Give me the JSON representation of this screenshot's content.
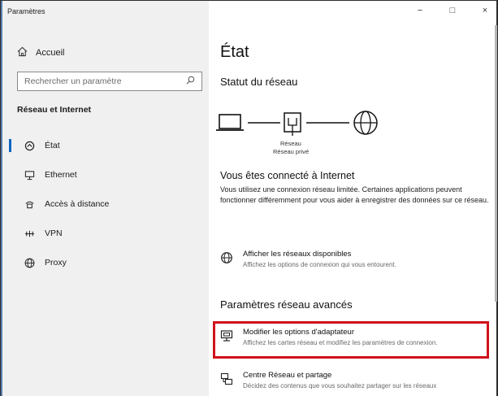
{
  "window": {
    "title": "Paramètres"
  },
  "controls": {
    "minimize": "−",
    "maximize": "□",
    "close": "×"
  },
  "sidebar": {
    "home_label": "Accueil",
    "search_placeholder": "Rechercher un paramètre",
    "section_title": "Réseau et Internet",
    "items": [
      {
        "label": "État",
        "icon": "status-icon",
        "active": true
      },
      {
        "label": "Ethernet",
        "icon": "ethernet-icon"
      },
      {
        "label": "Accès à distance",
        "icon": "dialup-icon"
      },
      {
        "label": "VPN",
        "icon": "vpn-icon"
      },
      {
        "label": "Proxy",
        "icon": "globe-icon"
      }
    ]
  },
  "main": {
    "title": "État",
    "network_status": "Statut du réseau",
    "diagram": {
      "label": "Réseau",
      "sublabel": "Réseau privé"
    },
    "connected_title": "Vous êtes connecté à Internet",
    "connected_desc": "Vous utilisez une connexion réseau limitée. Certaines applications peuvent fonctionner différemment pour vous aider à enregistrer des données sur ce réseau.",
    "links": [
      {
        "title": "Afficher les réseaux disponibles",
        "subtitle": "Affichez les options de connexion qui vous entourent.",
        "icon": "available-networks-icon"
      }
    ],
    "advanced_title": "Paramètres réseau avancés",
    "advanced_links": [
      {
        "title": "Modifier les options d'adaptateur",
        "subtitle": "Affichez les cartes réseau et modifiez les paramètres de connexion.",
        "icon": "adapter-icon",
        "highlighted": true
      },
      {
        "title": "Centre Réseau et partage",
        "subtitle": "Décidez des contenus que vous souhaitez partager sur les réseaux",
        "icon": "sharing-center-icon"
      }
    ]
  },
  "colors": {
    "accent": "#0a64c2",
    "highlight": "#d0121b",
    "sidebar_bg": "#f0f0f0"
  }
}
